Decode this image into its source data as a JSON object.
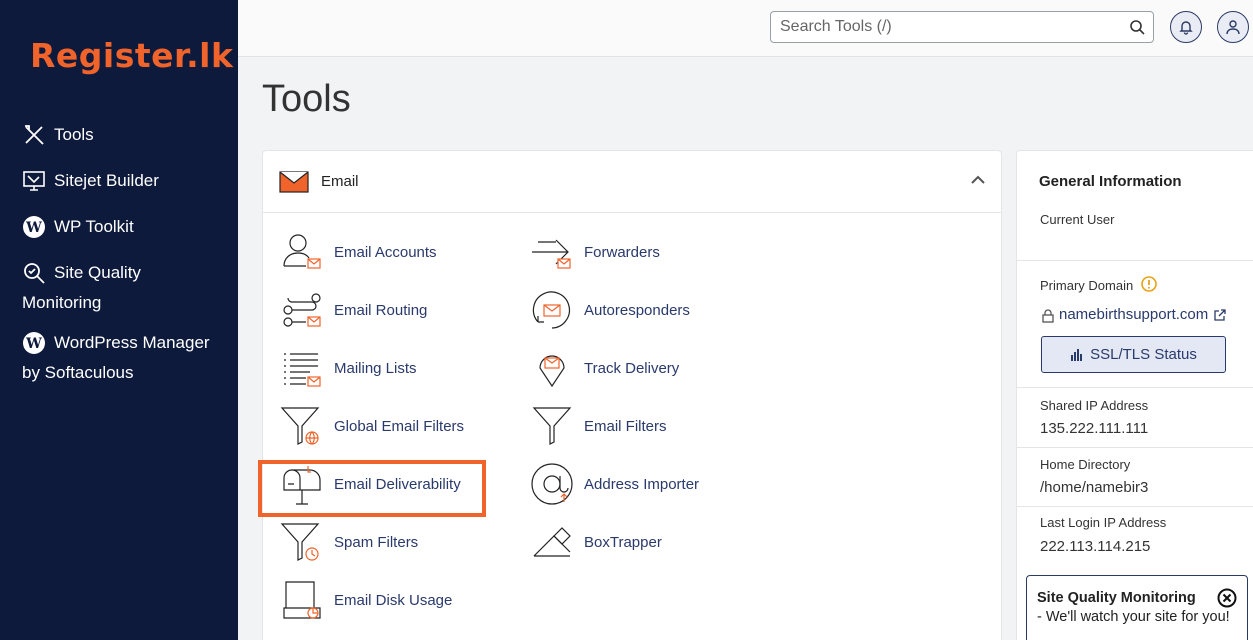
{
  "brand": {
    "name": "Register.lk",
    "accent": "#f0632b",
    "sidebar_bg": "#0e1a3c",
    "link_color": "#293a6b"
  },
  "sidebar": {
    "items": [
      {
        "label": "Tools",
        "icon": "tools-icon"
      },
      {
        "label": "Sitejet Builder",
        "icon": "sitejet-icon"
      },
      {
        "label": "WP Toolkit",
        "icon": "wordpress-icon"
      },
      {
        "label": "Site Quality",
        "label2": "Monitoring",
        "icon": "site-quality-icon"
      },
      {
        "label": "WordPress Manager",
        "label2": "by Softaculous",
        "icon": "wordpress-icon"
      }
    ]
  },
  "topbar": {
    "search_placeholder": "Search Tools (/)"
  },
  "page": {
    "title": "Tools"
  },
  "email_panel": {
    "title": "Email",
    "tools": [
      {
        "label": "Email Accounts",
        "icon": "email-accounts-icon"
      },
      {
        "label": "Forwarders",
        "icon": "forwarders-icon"
      },
      {
        "label": "Email Routing",
        "icon": "email-routing-icon"
      },
      {
        "label": "Autoresponders",
        "icon": "autoresponders-icon"
      },
      {
        "label": "Mailing Lists",
        "icon": "mailing-lists-icon"
      },
      {
        "label": "Track Delivery",
        "icon": "track-delivery-icon"
      },
      {
        "label": "Global Email Filters",
        "icon": "global-filter-icon"
      },
      {
        "label": "Email Filters",
        "icon": "filter-icon"
      },
      {
        "label": "Email Deliverability",
        "icon": "mailbox-icon"
      },
      {
        "label": "Address Importer",
        "icon": "address-importer-icon"
      },
      {
        "label": "Spam Filters",
        "icon": "spam-filter-icon"
      },
      {
        "label": "BoxTrapper",
        "icon": "boxtrapper-icon"
      },
      {
        "label": "Email Disk Usage",
        "icon": "disk-usage-icon"
      }
    ]
  },
  "general_info": {
    "title": "General Information",
    "current_user_label": "Current User",
    "primary_domain_label": "Primary Domain",
    "primary_domain": "namebirthsupport.com",
    "ssl_button": "SSL/TLS Status",
    "shared_ip_label": "Shared IP Address",
    "shared_ip": "135.222.111.111",
    "home_dir_label": "Home Directory",
    "home_dir": "/home/namebir3",
    "last_login_label": "Last Login IP Address",
    "last_login": "222.113.114.215"
  },
  "toast": {
    "title": "Site Quality Monitoring",
    "text": "- We'll watch your site for you!"
  }
}
